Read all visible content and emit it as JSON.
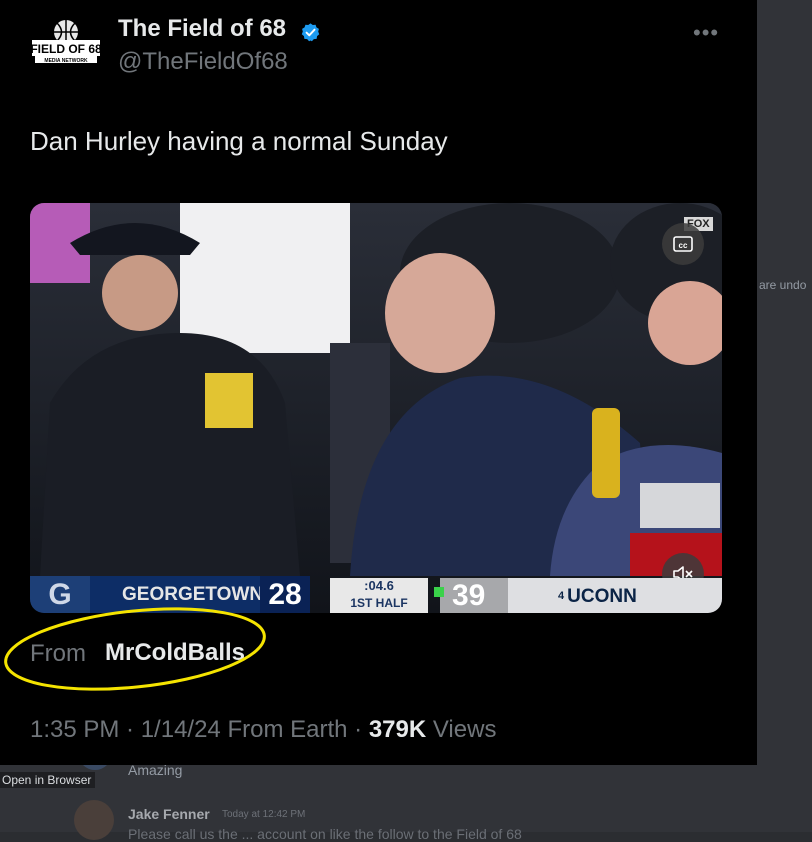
{
  "tweet": {
    "display_name": "The Field of 68",
    "handle": "@TheFieldOf68",
    "logo_text": "FIELD OF 68",
    "logo_subtext": "MEDIA NETWORK",
    "more_icon": "more-horizontal-icon",
    "text": "Dan Hurley having a normal Sunday",
    "video": {
      "broadcast_bug": "FOX",
      "cc_icon": "closed-captions-icon",
      "mute_icon": "volume-muted-icon",
      "scoreboard": {
        "team1": "GEORGETOWN",
        "score1": "28",
        "clock": ":04.6",
        "period": "1ST HALF",
        "score2": "39",
        "team2_seed": "4",
        "team2": "UCONN"
      }
    },
    "from_label": "From",
    "from_user": "MrColdBalls",
    "timestamp": "1:35 PM · 1/14/24 From Earth · ",
    "views_count": "379K",
    "views_label": " Views",
    "highlight_color": "#f5e400"
  },
  "chat": {
    "open_in_browser": "Open in Browser",
    "peek_text": "are undo",
    "previous_message": "Amazing",
    "author": "Jake Fenner",
    "time": "Today at 12:42 PM",
    "message_preview": "Please call us the ... account on like the follow to the Field of 68"
  },
  "colors": {
    "tweet_bg": "#000000",
    "verified_blue": "#1d9bf0",
    "muted_text": "#71767b"
  }
}
